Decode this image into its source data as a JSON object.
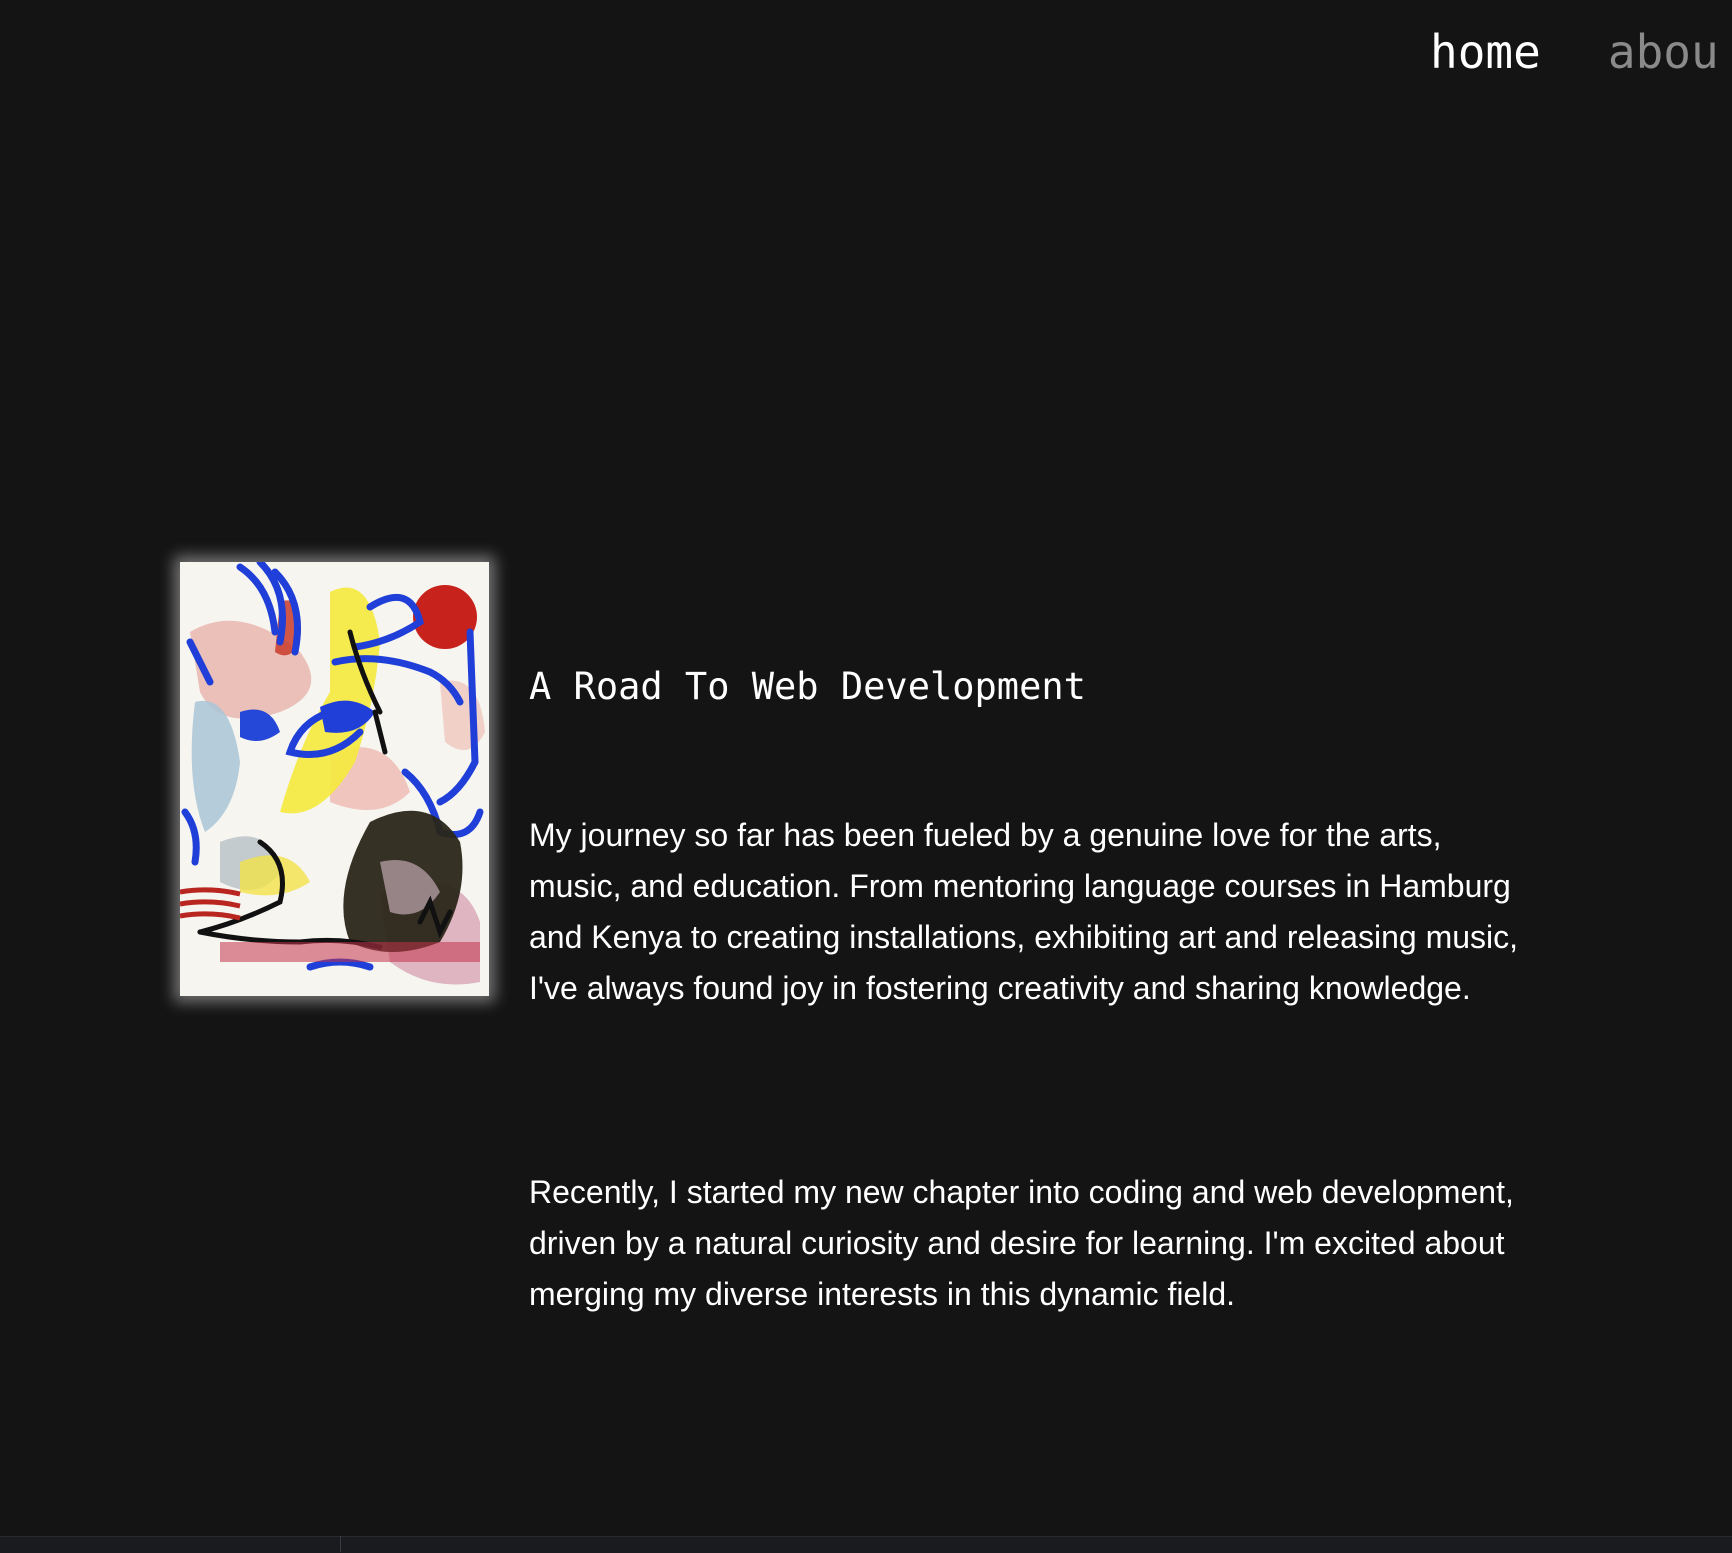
{
  "nav": {
    "items": [
      {
        "label": "home",
        "active": true
      },
      {
        "label": "abou",
        "active": false
      }
    ]
  },
  "main": {
    "title": "A Road To Web Development",
    "paragraphs": [
      "My journey so far has been fueled by a genuine love for the arts, music, and education. From mentoring language courses in Hamburg and Kenya to creating installations, exhibiting art and releasing music, I've always found joy in fostering creativity and sharing knowledge.",
      "Recently, I started my new chapter into coding and web development, driven by a natural curiosity and desire for learning. I'm excited about merging my diverse interests in this dynamic field."
    ]
  },
  "colors": {
    "background": "#141414",
    "text": "#ffffff",
    "nav_inactive": "#8a8a8a"
  }
}
